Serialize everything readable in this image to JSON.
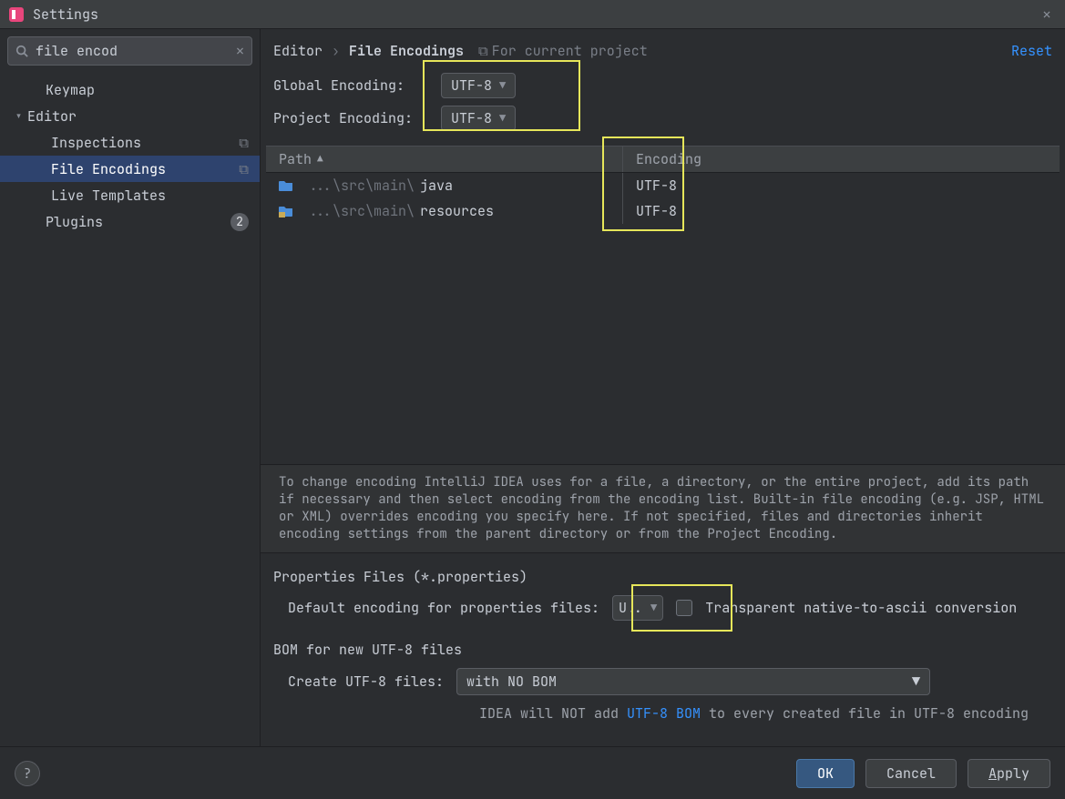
{
  "window": {
    "title": "Settings"
  },
  "search": {
    "value": "file encod"
  },
  "sidebar": {
    "items": [
      {
        "label": "Keymap"
      },
      {
        "label": "Editor"
      },
      {
        "label": "Inspections"
      },
      {
        "label": "File Encodings"
      },
      {
        "label": "Live Templates"
      },
      {
        "label": "Plugins",
        "badge": "2"
      }
    ]
  },
  "breadcrumb": {
    "a": "Editor",
    "b": "File Encodings",
    "scope": "For current project",
    "reset": "Reset"
  },
  "global": {
    "label": "Global Encoding:",
    "value": "UTF-8"
  },
  "project": {
    "label": "Project Encoding:",
    "value": "UTF-8"
  },
  "table": {
    "path_header": "Path",
    "enc_header": "Encoding",
    "rows": [
      {
        "dim": "...\\src\\main\\",
        "name": "java",
        "enc": "UTF-8",
        "icon": "folder"
      },
      {
        "dim": "...\\src\\main\\",
        "name": "resources",
        "enc": "UTF-8",
        "icon": "prop"
      }
    ]
  },
  "help_text": "To change encoding IntelliJ IDEA uses for a file, a directory, or the entire project, add its path if necessary and then select encoding from the encoding list. Built-in file encoding (e.g. JSP, HTML or XML) overrides encoding you specify here. If not specified, files and directories inherit encoding settings from the parent directory or from the Project Encoding.",
  "props": {
    "section": "Properties Files (*.properties)",
    "label": "Default encoding for properties files:",
    "value": "U..",
    "checkbox_label": "Transparent native-to-ascii conversion"
  },
  "bom": {
    "section": "BOM for new UTF-8 files",
    "label": "Create UTF-8 files:",
    "value": "with NO BOM",
    "hint_a": "IDEA will NOT add ",
    "hint_link": "UTF-8 BOM",
    "hint_b": " to every created file in UTF-8 encoding"
  },
  "footer": {
    "ok": "OK",
    "cancel": "Cancel",
    "apply": "Apply"
  }
}
